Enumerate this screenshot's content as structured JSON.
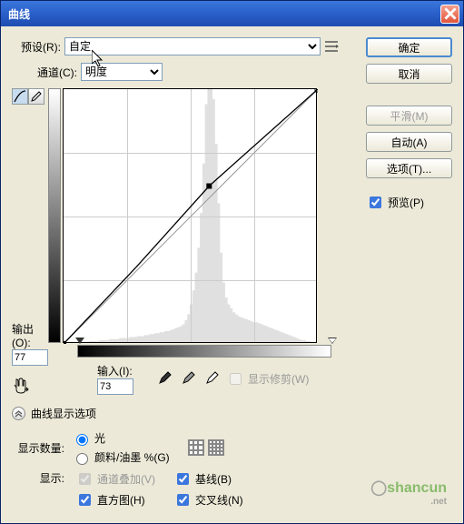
{
  "title": "曲线",
  "preset": {
    "label": "预设(R):",
    "value": "自定"
  },
  "channel": {
    "label": "通道(C):",
    "value": "明度"
  },
  "output": {
    "label": "输出(O):",
    "value": "77"
  },
  "input": {
    "label": "输入(I):",
    "value": "73"
  },
  "show_clipping": "显示修剪(W)",
  "display_options_header": "曲线显示选项",
  "amount": {
    "label": "显示数量:",
    "light": "光",
    "pigment": "颜料/油墨 %(G)"
  },
  "show": {
    "label": "显示:",
    "channel_overlay": "通道叠加(V)",
    "histogram": "直方图(H)",
    "baseline": "基线(B)",
    "intersect": "交叉线(N)"
  },
  "buttons": {
    "ok": "确定",
    "cancel": "取消",
    "smooth": "平滑(M)",
    "auto": "自动(A)",
    "options": "选项(T)..."
  },
  "preview_label": "预览(P)",
  "watermark": "shancun",
  "watermark_sub": ".net",
  "chart_data": {
    "type": "line",
    "title": "曲线",
    "xlabel": "输入",
    "ylabel": "输出",
    "xlim": [
      0,
      255
    ],
    "ylim": [
      0,
      255
    ],
    "series": [
      {
        "name": "baseline",
        "x": [
          0,
          255
        ],
        "y": [
          0,
          255
        ]
      },
      {
        "name": "curve",
        "x": [
          0,
          73,
          146,
          255
        ],
        "y": [
          0,
          77,
          158,
          255
        ]
      }
    ],
    "points": [
      {
        "x": 0,
        "y": 0
      },
      {
        "x": 146,
        "y": 158
      },
      {
        "x": 255,
        "y": 255
      }
    ],
    "selected_point": {
      "input": 73,
      "output": 77
    },
    "histogram": [
      0,
      0,
      0,
      0,
      0,
      0,
      0,
      0,
      0,
      0,
      1,
      1,
      1,
      1,
      2,
      2,
      2,
      2,
      3,
      3,
      3,
      3,
      4,
      4,
      4,
      4,
      5,
      5,
      5,
      6,
      6,
      6,
      7,
      7,
      8,
      8,
      9,
      9,
      10,
      10,
      11,
      11,
      12,
      13,
      14,
      15,
      16,
      18,
      22,
      28,
      38,
      52,
      70,
      95,
      130,
      180,
      240,
      255,
      255,
      245,
      200,
      140,
      90,
      60,
      45,
      38,
      34,
      30,
      28,
      26,
      25,
      24,
      23,
      22,
      21,
      20,
      20,
      19,
      18,
      17,
      16,
      15,
      14,
      13,
      12,
      11,
      10,
      9,
      8,
      7,
      6,
      5,
      4,
      3,
      2,
      2,
      1,
      1,
      0,
      0
    ]
  }
}
